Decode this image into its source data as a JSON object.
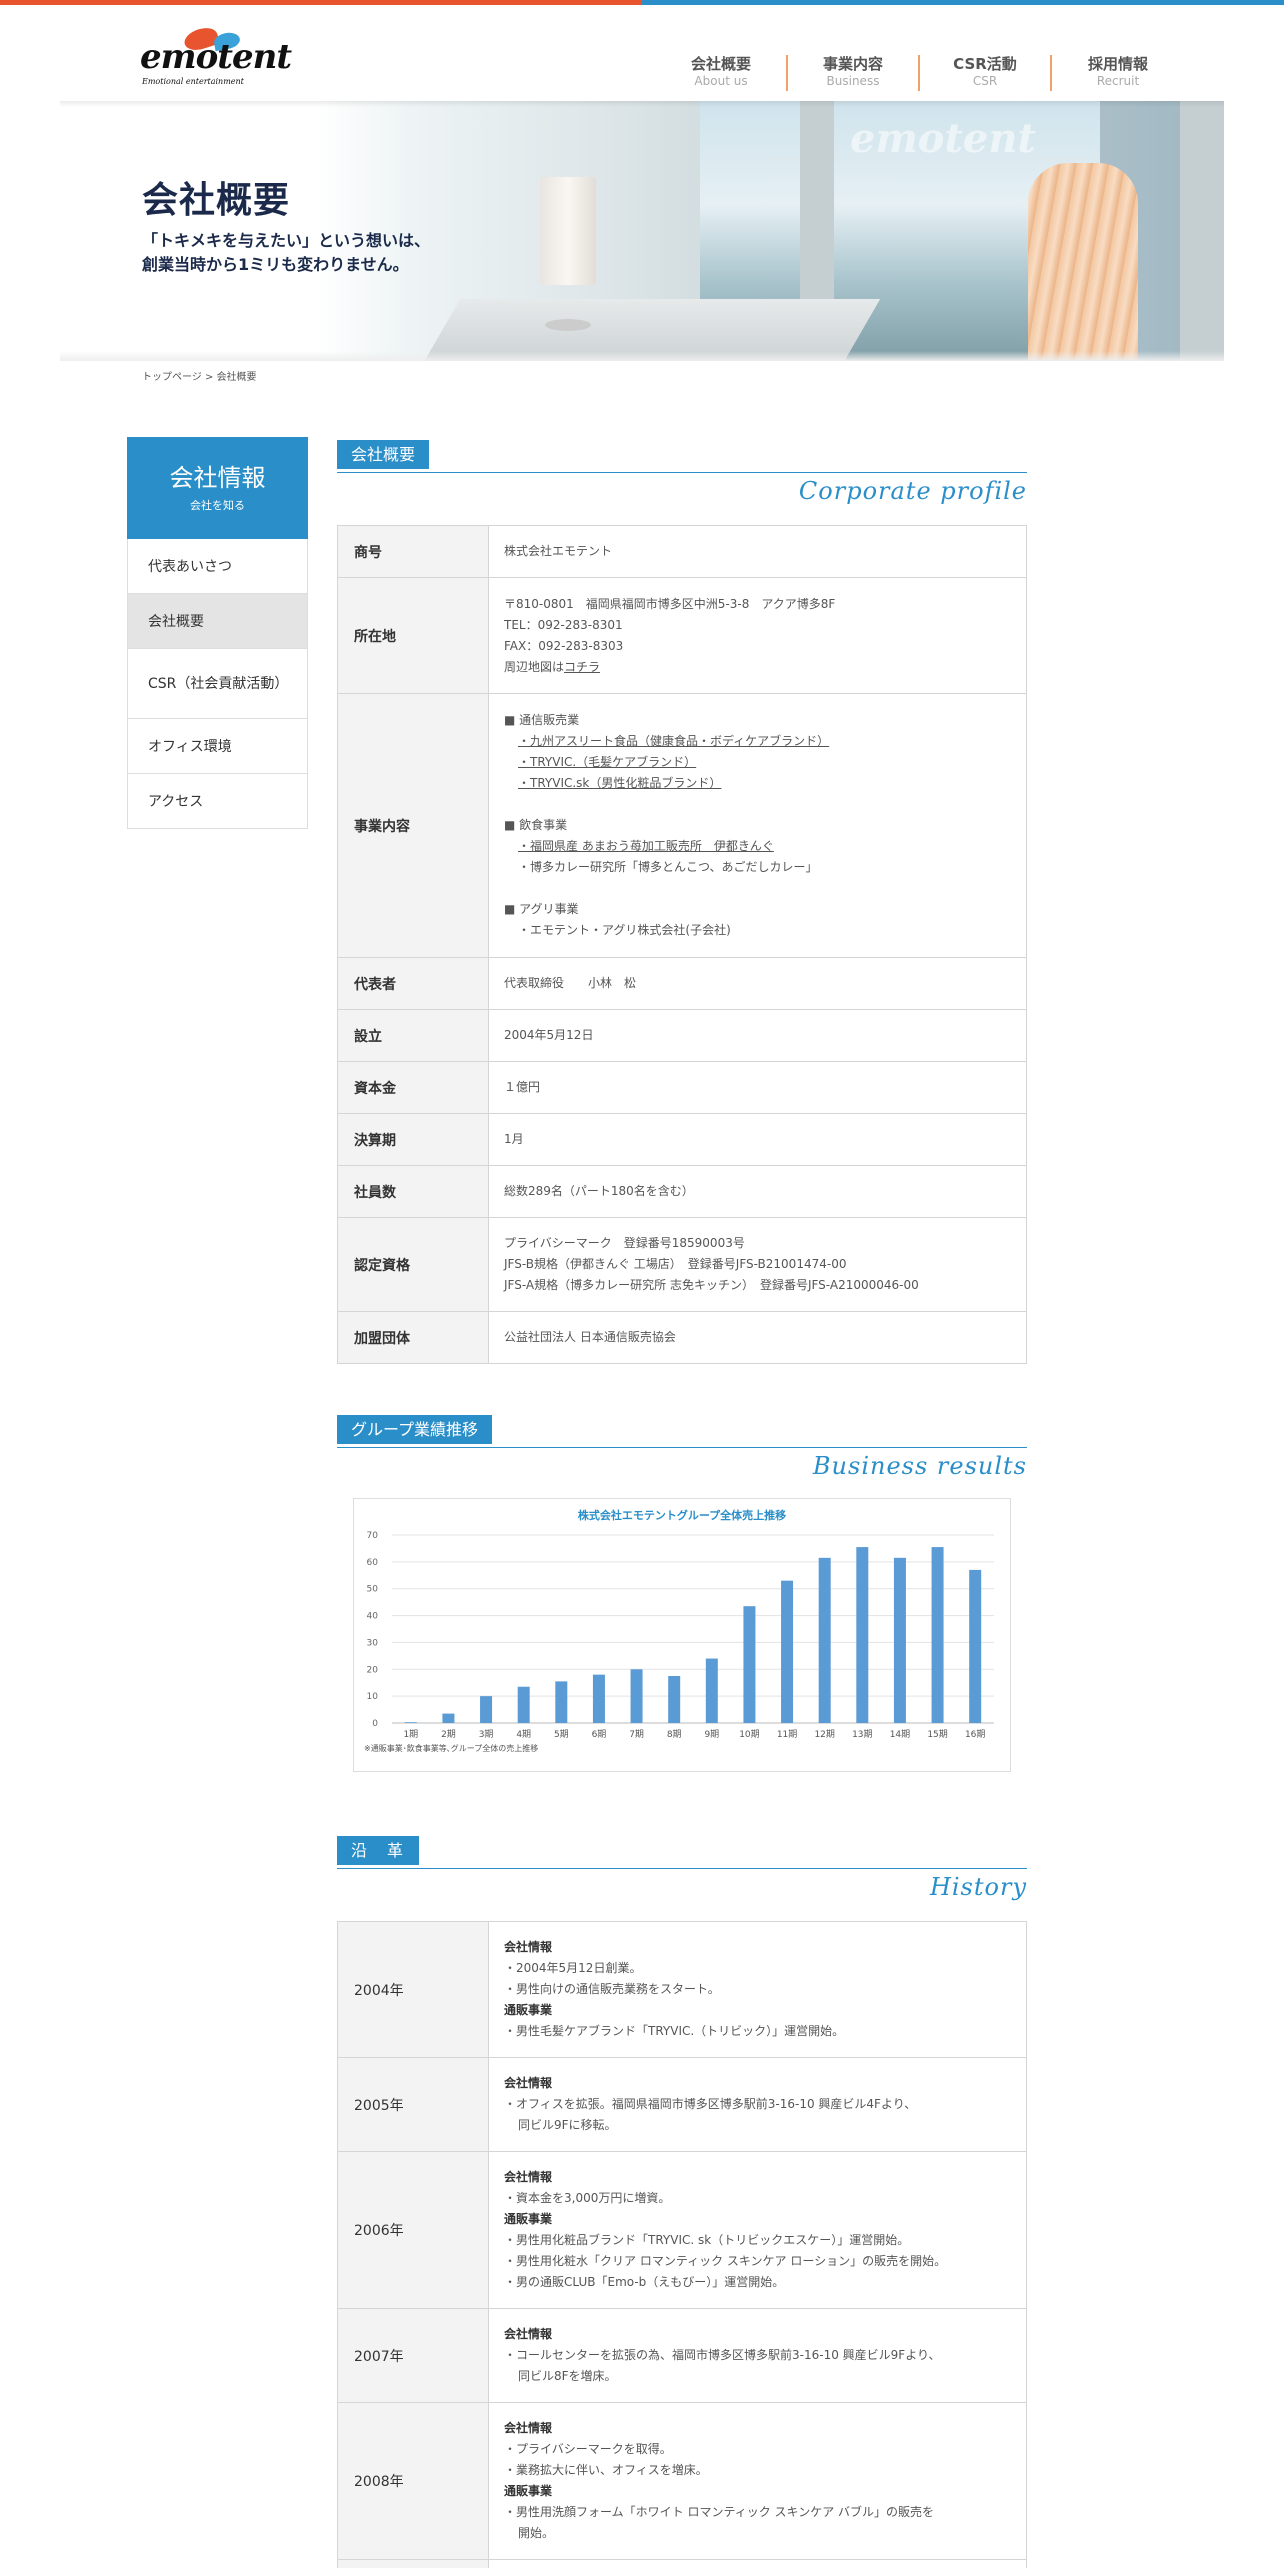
{
  "header": {
    "logo_main": "emotent",
    "logo_sub": "Emotional entertainment",
    "nav": [
      {
        "ja": "会社概要",
        "en": "About us"
      },
      {
        "ja": "事業内容",
        "en": "Business"
      },
      {
        "ja": "CSR活動",
        "en": "CSR"
      },
      {
        "ja": "採用情報",
        "en": "Recruit"
      }
    ]
  },
  "hero": {
    "title": "会社概要",
    "copy1": "「トキメキを与えたい」という想いは、",
    "copy2": "創業当時から1ミリも変わりません。",
    "watermark": "emotent"
  },
  "breadcrumb": {
    "home": "トップページ",
    "sep": " > ",
    "current": "会社概要"
  },
  "sidebar": {
    "title": "会社情報",
    "subtitle": "会社を知る",
    "items": [
      "代表あいさつ",
      "会社概要",
      "CSR（社会貢献活動）",
      "オフィス環境",
      "アクセス"
    ]
  },
  "profile": {
    "label": "会社概要",
    "en": "Corporate profile",
    "rows": {
      "name_h": "商号",
      "name_v": "株式会社エモテント",
      "addr_h": "所在地",
      "addr_1": "〒810-0801　福岡県福岡市博多区中洲5-3-8　アクア博多8F",
      "addr_2": "TEL：092-283-8301",
      "addr_3": "FAX：092-283-8303",
      "addr_4a": "周辺地図は",
      "addr_4b": "コチラ",
      "biz_h": "事業内容",
      "biz_1": "■ 通信販売業",
      "biz_2": "・九州アスリート食品（健康食品・ボディケアブランド）",
      "biz_3": "・TRYVIC.（毛髪ケアブランド）",
      "biz_4": "・TRYVIC.sk（男性化粧品ブランド）",
      "biz_5": "■ 飲食事業",
      "biz_6": "・福岡県産 あまおう苺加工販売所　伊都きんぐ",
      "biz_7": "・博多カレー研究所「博多とんこつ、あごだしカレー」",
      "biz_8": "■ アグリ事業",
      "biz_9": "・エモテント・アグリ株式会社(子会社)",
      "rep_h": "代表者",
      "rep_v": "代表取締役　　小林　松",
      "est_h": "設立",
      "est_v": "2004年5月12日",
      "cap_h": "資本金",
      "cap_v": "１億円",
      "fy_h": "決算期",
      "fy_v": "1月",
      "emp_h": "社員数",
      "emp_v": "総数289名（パート180名を含む）",
      "cert_h": "認定資格",
      "cert_1": "プライバシーマーク　登録番号18590003号",
      "cert_2": "JFS-B規格（伊都きんぐ 工場店）　登録番号JFS-B21001474-00",
      "cert_3": "JFS-A規格（博多カレー研究所 志免キッチン）　登録番号JFS-A21000046-00",
      "mem_h": "加盟団体",
      "mem_v": "公益社団法人 日本通信販売協会"
    }
  },
  "results": {
    "label": "グループ業績推移",
    "en": "Business results",
    "note": "※通販事業･飲食事業等､グループ全体の売上推移"
  },
  "chart_data": {
    "type": "bar",
    "title": "株式会社エモテントグループ全体売上推移",
    "categories": [
      "1期",
      "2期",
      "3期",
      "4期",
      "5期",
      "6期",
      "7期",
      "8期",
      "9期",
      "10期",
      "11期",
      "12期",
      "13期",
      "14期",
      "15期",
      "16期"
    ],
    "values": [
      0.3,
      3.5,
      10,
      13.5,
      15.5,
      18,
      20,
      17.5,
      24,
      43.5,
      53,
      61.5,
      65.5,
      61.5,
      65.5,
      57
    ],
    "ylim": [
      0,
      70
    ],
    "yticks": [
      "0",
      "10",
      "20",
      "30",
      "40",
      "50",
      "60",
      "70"
    ],
    "grid": true,
    "bar_color": "#5b9bd5"
  },
  "history": {
    "label": "沿　革",
    "en": "History",
    "h_company": "会社情報",
    "h_mail": "通販事業",
    "y2004": "2004年",
    "y2004_1": "・2004年5月12日創業。",
    "y2004_2": "・男性向けの通信販売業務をスタート。",
    "y2004_3": "・男性毛髪ケアブランド「TRYVIC.（トリビック）」運営開始。",
    "y2005": "2005年",
    "y2005_1": "・オフィスを拡張。福岡県福岡市博多区博多駅前3-16-10 興産ビル4Fより、",
    "y2005_2": "同ビル9Fに移転。",
    "y2006": "2006年",
    "y2006_1": "・資本金を3,000万円に増資。",
    "y2006_2": "・男性用化粧品ブランド「TRYVIC. sk（トリビックエスケー）」運営開始。",
    "y2006_3": "・男性用化粧水「クリア ロマンティック スキンケア ローション」の販売を開始。",
    "y2006_4": "・男の通販CLUB「Emo-b（えもびー）」運営開始。",
    "y2007": "2007年",
    "y2007_1": "・コールセンターを拡張の為、福岡市博多区博多駅前3-16-10 興産ビル9Fより、",
    "y2007_2": "同ビル8Fを増床。",
    "y2008": "2008年",
    "y2008_1": "・プライバシーマークを取得。",
    "y2008_2": "・業務拡大に伴い、オフィスを増床。",
    "y2008_3": "・男性用洗顔フォーム「ホワイト ロマンティック スキンケア バブル」の販売を",
    "y2008_4": "開始。"
  }
}
